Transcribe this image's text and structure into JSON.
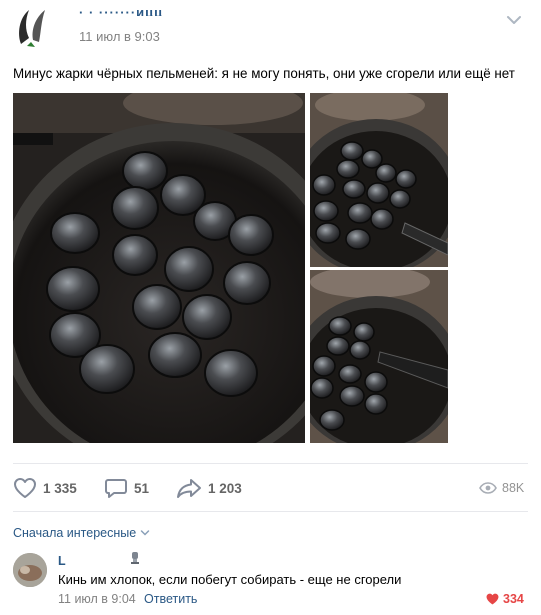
{
  "post": {
    "author": "· ·  ·······ицц",
    "time": "11 июл в 9:03",
    "text": "Минус жарки чёрных пельменей: я не могу понять, они уже сгорели или ещё нет",
    "photos": [
      {
        "description_icon": "photo-icon"
      },
      {
        "description_icon": "photo-icon"
      },
      {
        "description_icon": "photo-icon"
      }
    ]
  },
  "actions": {
    "likes": "1 335",
    "comments": "51",
    "shares": "1 203",
    "views": "88K"
  },
  "comments": {
    "sort_label": "Сначала интересные",
    "items": [
      {
        "author": "L",
        "text": "Кинь им хлопок, если побегут собирать - еще не сгорели",
        "time": "11 июл в 9:04",
        "reply_label": "Ответить",
        "likes": "334"
      }
    ]
  },
  "colors": {
    "link": "#2a5885",
    "meta": "#828282",
    "like_active": "#e64646",
    "icon": "#828a99"
  }
}
